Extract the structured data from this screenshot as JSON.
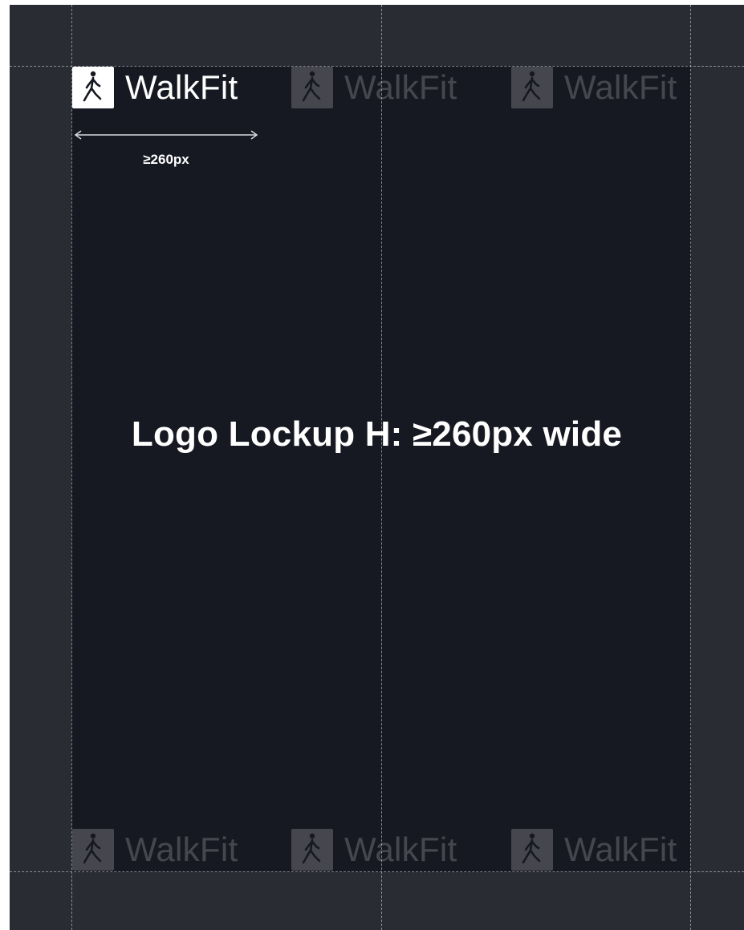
{
  "brand": {
    "name": "WalkFit",
    "icon": "walking-person-icon"
  },
  "measurement": {
    "label": "≥260px"
  },
  "caption": "Logo Lockup H: ≥260px wide",
  "colors": {
    "frame": "#2a2c34",
    "artboard": "#171922",
    "mark": "#ffffff",
    "text": "#ffffff"
  },
  "ghost_lockups": [
    {
      "name": "WalkFit"
    },
    {
      "name": "WalkFit"
    },
    {
      "name": "WalkFit"
    },
    {
      "name": "WalkFit"
    },
    {
      "name": "WalkFit"
    }
  ]
}
